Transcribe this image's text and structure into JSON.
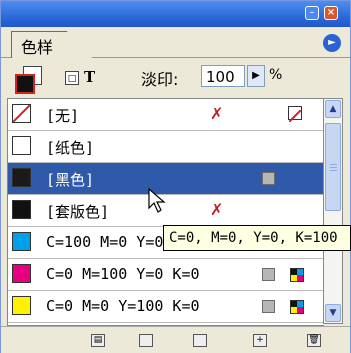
{
  "panel": {
    "tab_label": "色样",
    "menu_icon": "flyout-menu-icon"
  },
  "toolbar": {
    "text_glyph": "T",
    "tint_label": "淡印:",
    "tint_value": "100",
    "tint_unit": "%"
  },
  "swatches": [
    {
      "label": "[无]",
      "color": "#ffffff",
      "none": true
    },
    {
      "label": "[纸色]",
      "color": "#ffffff"
    },
    {
      "label": "[黑色]",
      "color": "#1a1a1a",
      "selected": true
    },
    {
      "label": "[套版色]",
      "color": "#111111"
    },
    {
      "label": "C=100 M=0 Y=0 K=0",
      "color": "#00a0e9"
    },
    {
      "label": "C=0 M=100 Y=0 K=0",
      "color": "#e4007f"
    },
    {
      "label": "C=0 M=0 Y=100 K=0",
      "color": "#fff100"
    }
  ],
  "tooltip": {
    "text": "C=0, M=0, Y=0, K=100"
  }
}
